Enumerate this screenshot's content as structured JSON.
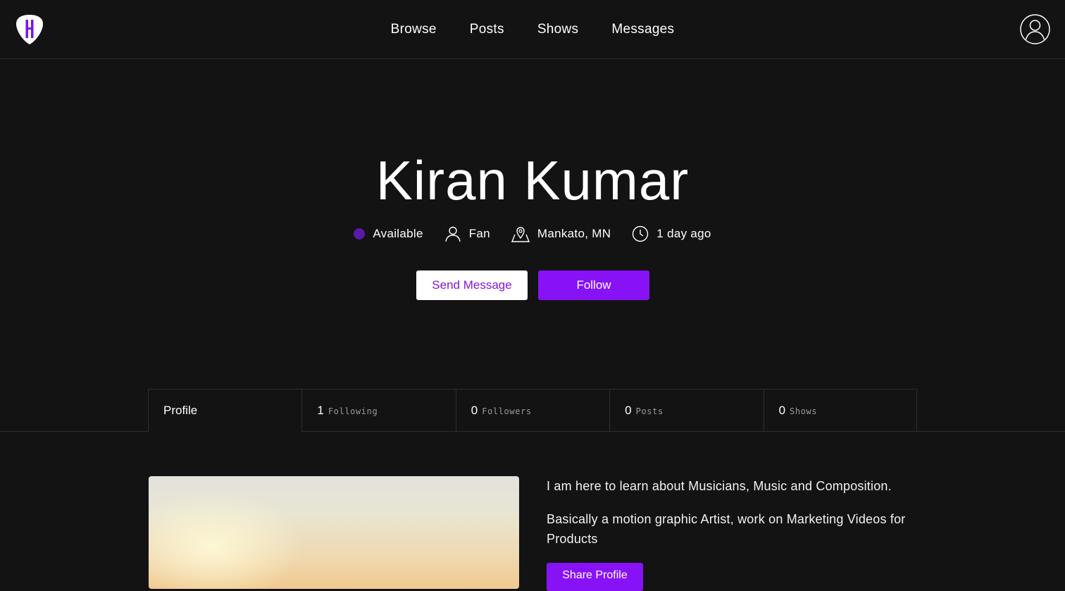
{
  "nav": {
    "items": [
      {
        "label": "Browse"
      },
      {
        "label": "Posts"
      },
      {
        "label": "Shows"
      },
      {
        "label": "Messages"
      }
    ]
  },
  "profile": {
    "name": "Kiran Kumar",
    "status": "Available",
    "role": "Fan",
    "location": "Mankato, MN",
    "last_active": "1 day ago"
  },
  "actions": {
    "send_message": "Send Message",
    "follow": "Follow"
  },
  "tabs": [
    {
      "label": "Profile"
    },
    {
      "count": "1",
      "label": "Following"
    },
    {
      "count": "0",
      "label": "Followers"
    },
    {
      "count": "0",
      "label": "Posts"
    },
    {
      "count": "0",
      "label": "Shows"
    }
  ],
  "bio": {
    "paragraphs": [
      "I am here to learn about Musicians, Music and Composition.",
      "Basically a motion graphic Artist, work on Marketing Videos for Products"
    ],
    "share_button": "Share Profile"
  },
  "colors": {
    "background": "#131313",
    "accent": "#8712f5",
    "status_dot": "#5a1aa8"
  },
  "icons": {
    "logo": "guitar-pick-logo-icon",
    "avatar": "user-circle-icon",
    "role": "person-icon",
    "location": "map-pin-icon",
    "time": "clock-icon"
  }
}
